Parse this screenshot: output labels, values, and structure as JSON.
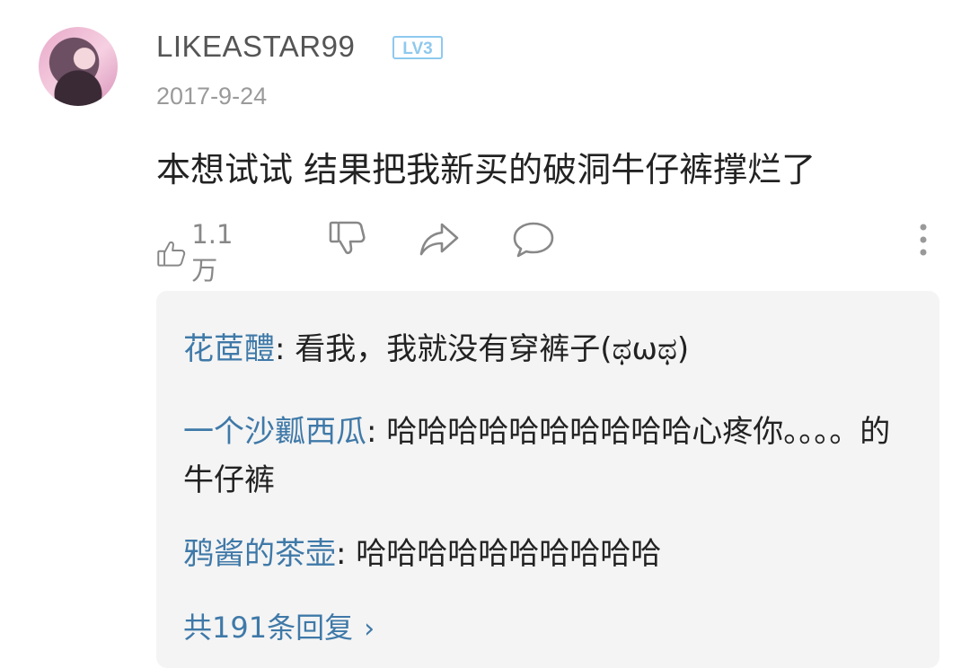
{
  "comment": {
    "username": "LIKEASTAR99",
    "level_badge": "LV3",
    "date": "2017-9-24",
    "text": "本想试试  结果把我新买的破洞牛仔裤撑烂了",
    "like_count": "1.1万",
    "icons": [
      "thumbs-up-icon",
      "thumbs-down-icon",
      "share-icon",
      "comment-icon",
      "more-vertical-icon"
    ]
  },
  "replies": {
    "items": [
      {
        "name": "花茝醴",
        "sep": ": ",
        "text": "看我，我就没有穿裤子(ಥωಥ)"
      },
      {
        "name": "一个沙瓤西瓜",
        "sep": ": ",
        "text": "哈哈哈哈哈哈哈哈哈哈心疼你。。。。的牛仔裤"
      },
      {
        "name": "鸦酱的茶壶",
        "sep": ": ",
        "text": "哈哈哈哈哈哈哈哈哈哈"
      }
    ],
    "more_label": "共191条回复",
    "more_chevron": "›"
  },
  "colors": {
    "link": "#3f79a8",
    "badge": "#8fc9ee",
    "panel_bg": "#f4f4f4"
  }
}
